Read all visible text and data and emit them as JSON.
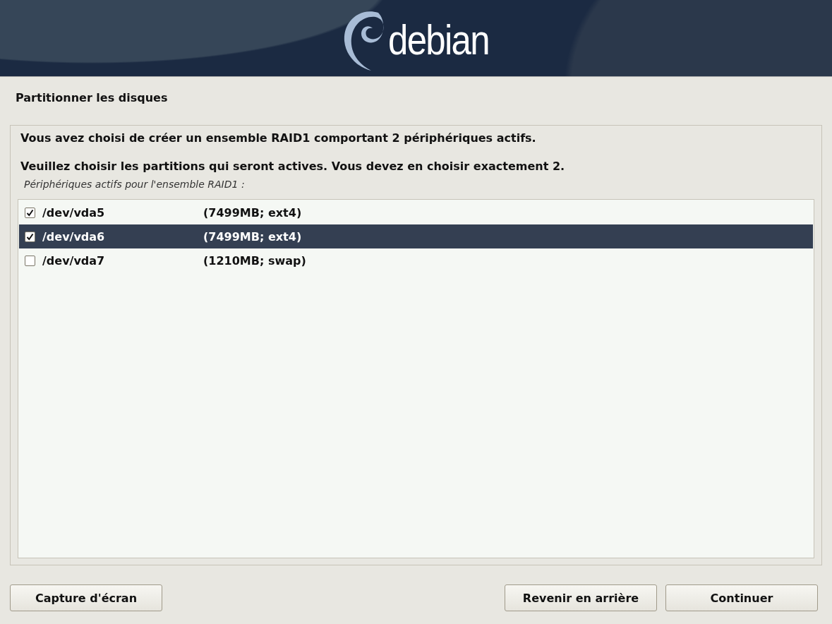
{
  "header": {
    "logo_text": "debian"
  },
  "title": "Partitionner les disques",
  "messages": [
    "Vous avez choisi de créer un ensemble RAID1 comportant 2 périphériques actifs.",
    "Veuillez choisir les partitions qui seront actives. Vous devez en choisir exactement 2."
  ],
  "list_label": "Périphériques actifs pour l'ensemble RAID1 :",
  "partitions": [
    {
      "device": "/dev/vda5",
      "info": "(7499MB; ext4)",
      "checked": true,
      "selected": false
    },
    {
      "device": "/dev/vda6",
      "info": "(7499MB; ext4)",
      "checked": true,
      "selected": true
    },
    {
      "device": "/dev/vda7",
      "info": "(1210MB; swap)",
      "checked": false,
      "selected": false
    }
  ],
  "buttons": {
    "left": [
      "Capture d'écran"
    ],
    "right": [
      "Revenir en arrière",
      "Continuer"
    ]
  }
}
